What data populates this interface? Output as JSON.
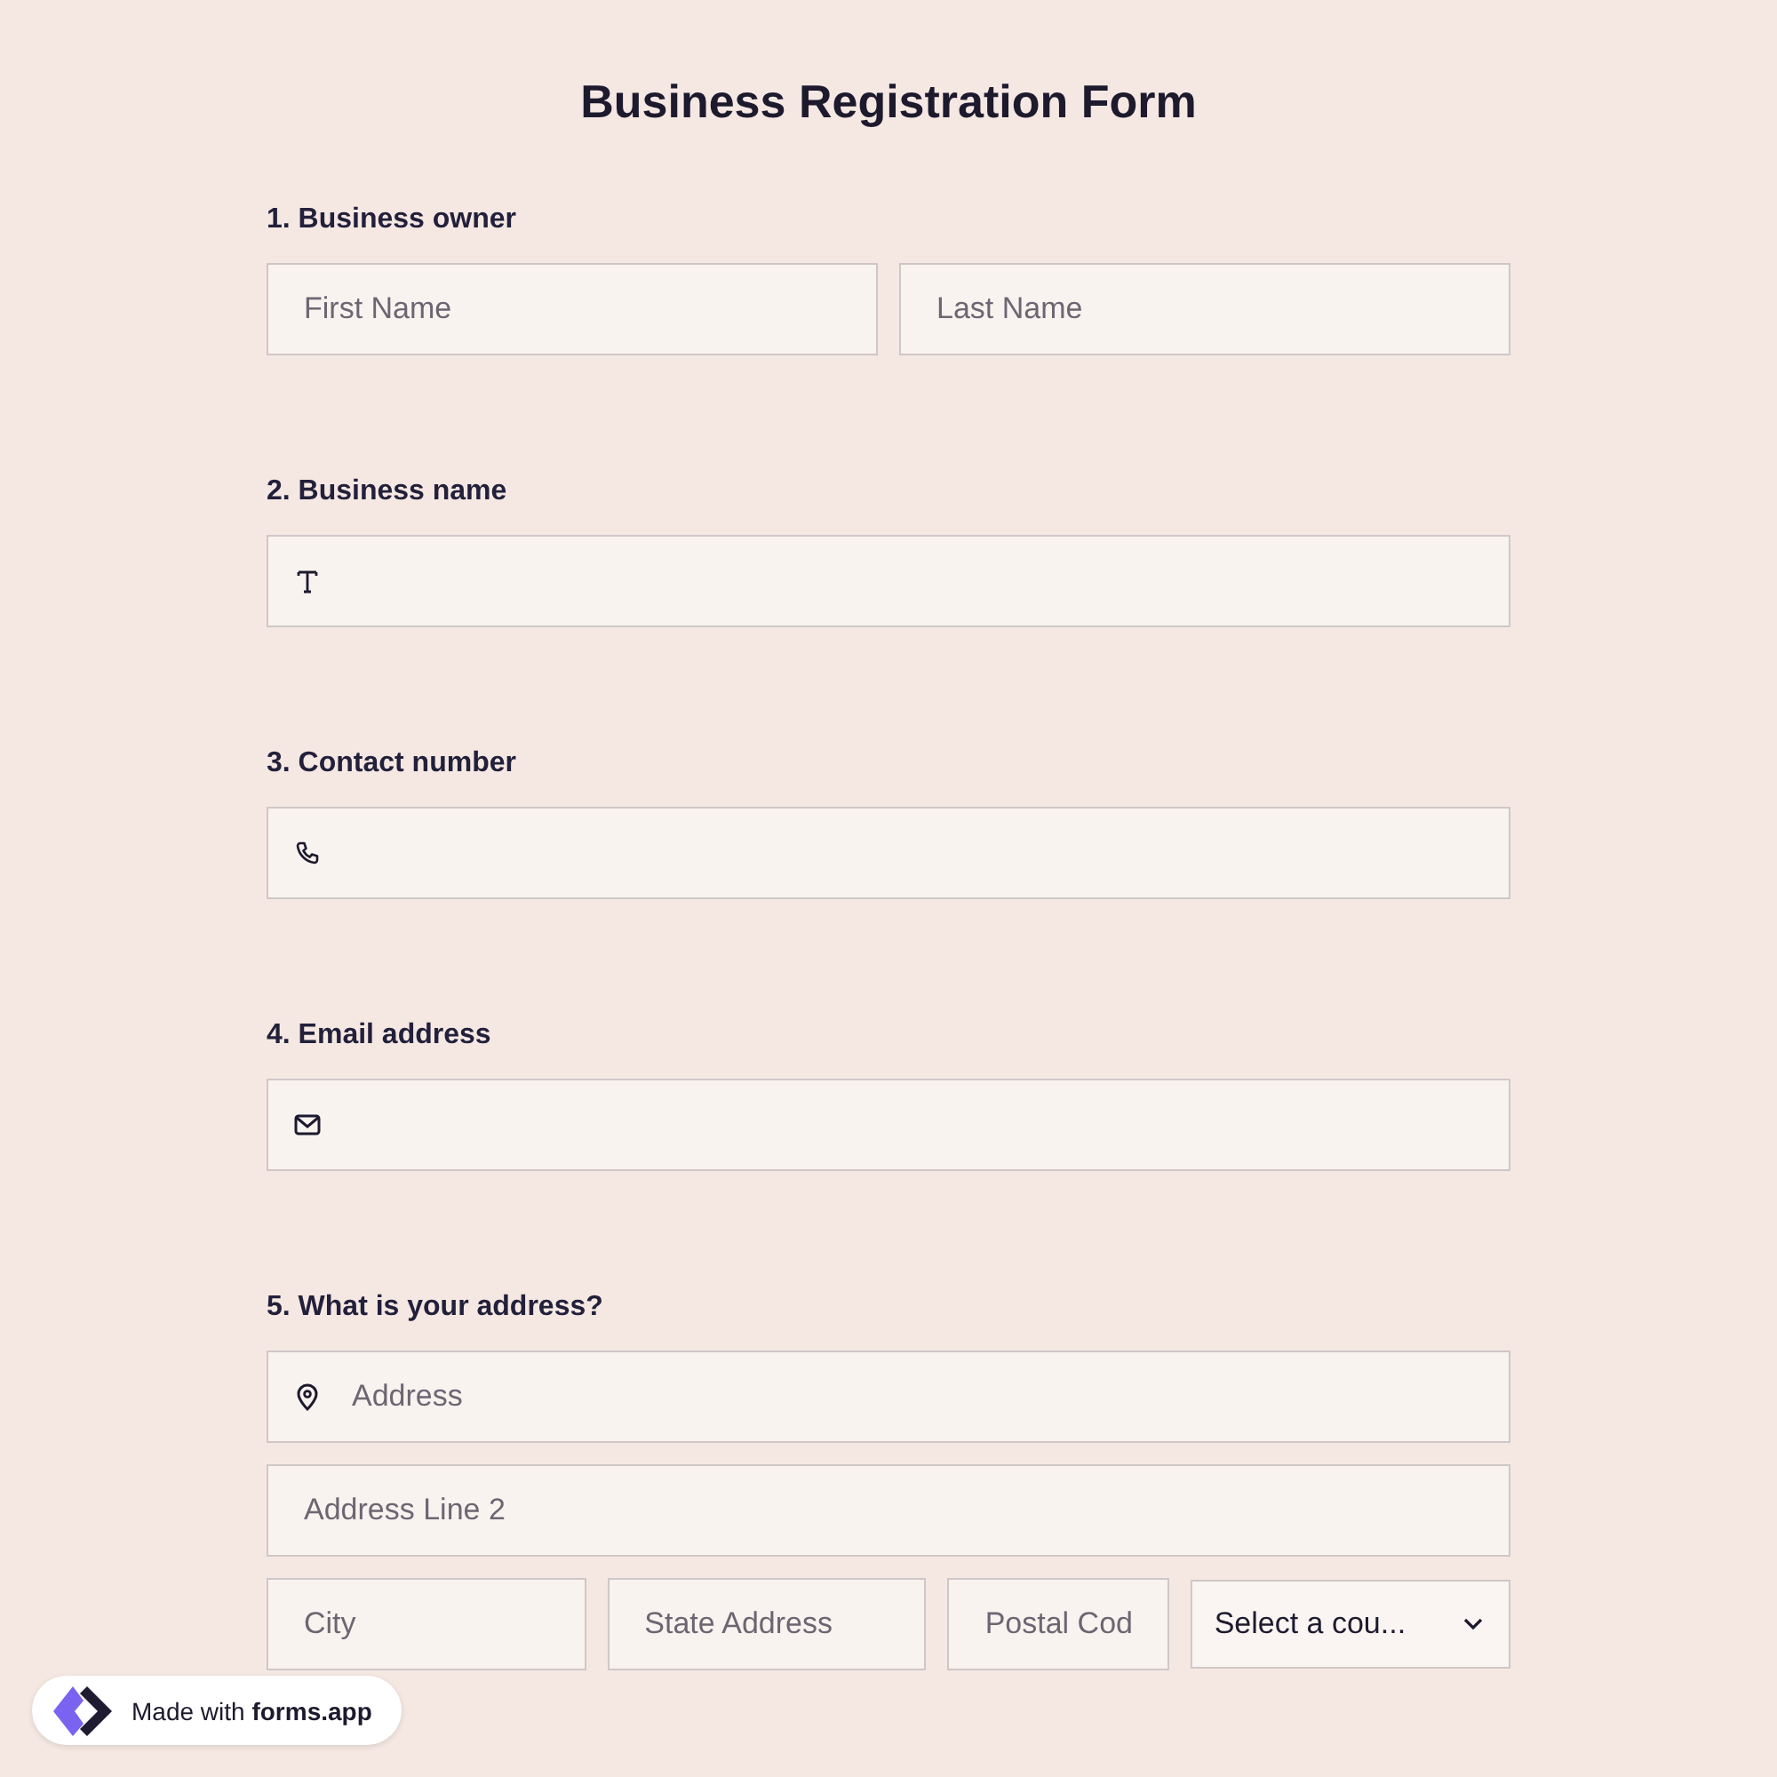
{
  "title": "Business Registration Form",
  "questions": [
    {
      "label": "1.  Business owner",
      "rows": [
        [
          {
            "kind": "input",
            "placeholder": "First Name"
          },
          {
            "kind": "input",
            "placeholder": "Last Name"
          }
        ]
      ]
    },
    {
      "label": "2. Business name",
      "rows": [
        [
          {
            "kind": "text_input"
          }
        ]
      ]
    },
    {
      "label": "3. Contact number",
      "rows": [
        [
          {
            "kind": "phone_input"
          }
        ]
      ]
    },
    {
      "label": "4. Email address",
      "rows": [
        [
          {
            "kind": "email_input"
          }
        ]
      ]
    },
    {
      "label": "5. What is your address?",
      "rows": [
        [
          {
            "kind": "address_input",
            "placeholder": "Address"
          }
        ],
        [
          {
            "kind": "input",
            "placeholder": "Address Line 2"
          }
        ],
        [
          {
            "kind": "input",
            "placeholder": "City"
          },
          {
            "kind": "input",
            "placeholder": "State Address"
          },
          {
            "kind": "input",
            "placeholder": "Postal Cod"
          },
          {
            "kind": "select",
            "value": "Select a cou..."
          }
        ]
      ]
    }
  ],
  "badge": {
    "prefix": "Made with",
    "brand": "forms.app"
  }
}
